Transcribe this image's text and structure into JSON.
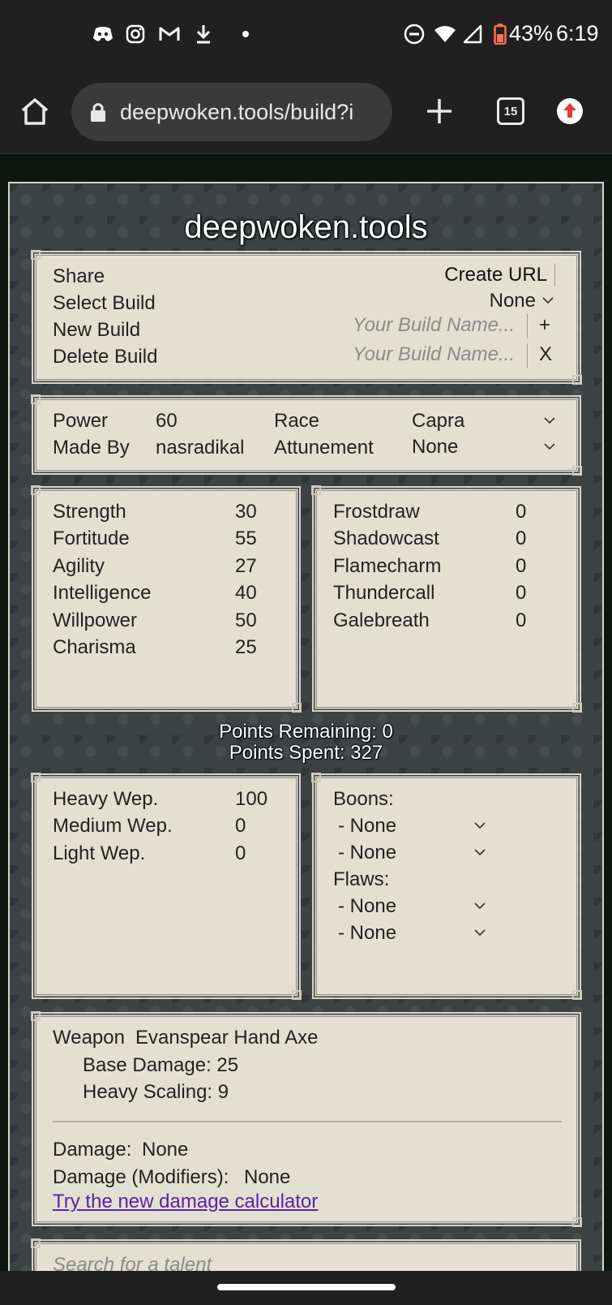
{
  "status": {
    "battery": "43%",
    "time": "6:19"
  },
  "browser": {
    "url": "deepwoken.tools/build?i",
    "tab_count": "15"
  },
  "site": {
    "title": "deepwoken.tools"
  },
  "build_panel": {
    "share_label": "Share",
    "create_url_label": "Create URL",
    "select_build_label": "Select Build",
    "select_build_value": "None",
    "new_build_label": "New Build",
    "new_build_placeholder": "Your Build Name...",
    "add_label": "+",
    "delete_build_label": "Delete Build",
    "delete_build_placeholder": "Your Build Name...",
    "delete_label": "X"
  },
  "info_panel": {
    "power_label": "Power",
    "power_value": "60",
    "made_by_label": "Made By",
    "made_by_value": "nasradikal",
    "race_label": "Race",
    "race_value": "Capra",
    "attunement_label": "Attunement",
    "attunement_value": "None"
  },
  "attributes": [
    {
      "name": "Strength",
      "value": "30"
    },
    {
      "name": "Fortitude",
      "value": "55"
    },
    {
      "name": "Agility",
      "value": "27"
    },
    {
      "name": "Intelligence",
      "value": "40"
    },
    {
      "name": "Willpower",
      "value": "50"
    },
    {
      "name": "Charisma",
      "value": "25"
    }
  ],
  "attunements": [
    {
      "name": "Frostdraw",
      "value": "0"
    },
    {
      "name": "Shadowcast",
      "value": "0"
    },
    {
      "name": "Flamecharm",
      "value": "0"
    },
    {
      "name": "Thundercall",
      "value": "0"
    },
    {
      "name": "Galebreath",
      "value": "0"
    }
  ],
  "points": {
    "remaining": "Points Remaining: 0",
    "spent": "Points Spent: 327"
  },
  "weapons": [
    {
      "name": "Heavy Wep.",
      "value": "100"
    },
    {
      "name": "Medium Wep.",
      "value": "0"
    },
    {
      "name": "Light Wep.",
      "value": "0"
    }
  ],
  "boons_flaws": {
    "boons_label": "Boons:",
    "boons": [
      "- None",
      "- None"
    ],
    "flaws_label": "Flaws:",
    "flaws": [
      "- None",
      "- None"
    ]
  },
  "weapon_panel": {
    "weapon_label": "Weapon",
    "weapon_value": "Evanspear Hand Axe",
    "base_damage": "Base Damage: 25",
    "heavy_scaling": "Heavy Scaling: 9",
    "damage_label": "Damage:",
    "damage_value": "None",
    "damage_mod_label": "Damage (Modifiers):",
    "damage_mod_value": "None",
    "calculator_link": "Try the new damage calculator"
  },
  "talent_search": {
    "placeholder": "Search for a talent"
  },
  "colors": {
    "card_bg": "#e4e0d1",
    "page_bg": "#3d4245",
    "link": "#5a22a8"
  }
}
